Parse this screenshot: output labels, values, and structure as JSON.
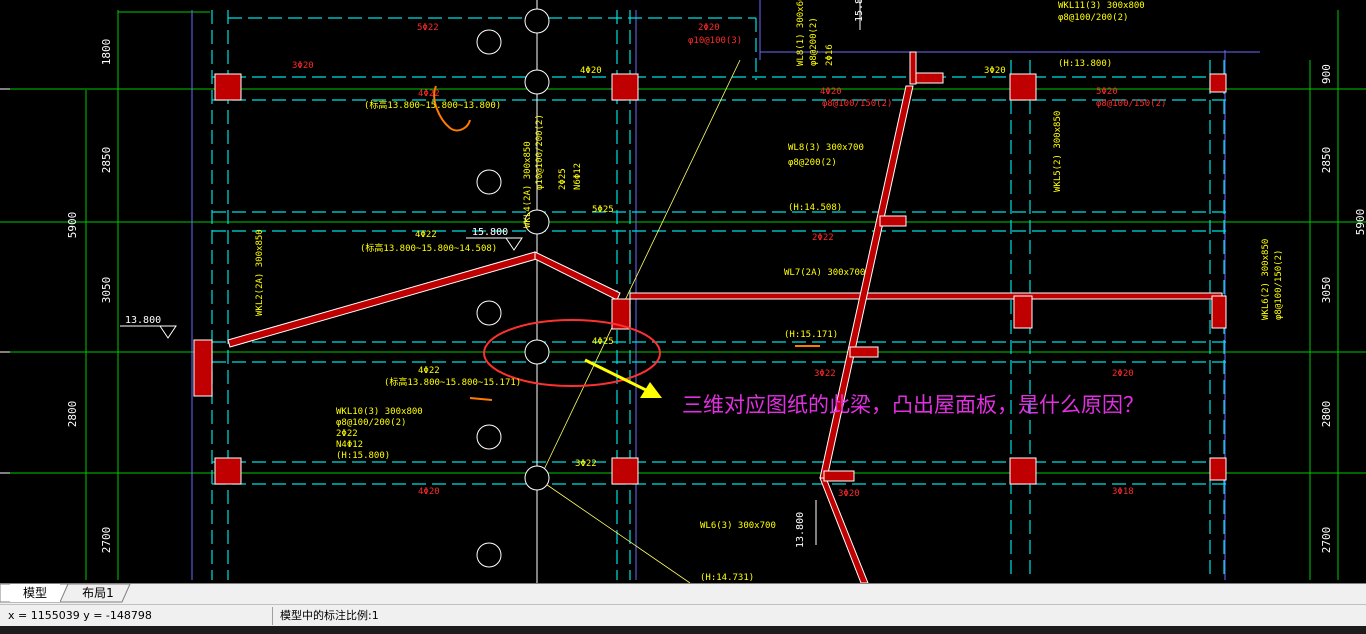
{
  "colors": {
    "background": "#000000",
    "axis": "#00c800",
    "dashed": "#00ffff",
    "beam_fill": "#c00000",
    "beam_edge": "#ffffff",
    "annot_yellow": "#ffff00",
    "annot_red": "#ff2a2a",
    "question_magenta": "#e030e0",
    "ellipse_red": "#ff3030",
    "arrow_yellow": "#ffff00",
    "orange_scribble": "#ff7a00",
    "circle_white": "#ffffff",
    "blue_line": "#6a6aff"
  },
  "dimensions_left": [
    "1800",
    "2850",
    "5900",
    "3050",
    "2800",
    "2700"
  ],
  "dimensions_right": [
    "900",
    "2850",
    "5900",
    "3050",
    "2800",
    "2700"
  ],
  "elevation_marks": [
    "13.800",
    "15.800",
    "15.800",
    "13.800"
  ],
  "beam_labels_yellow": [
    "WKL10(3) 300x800",
    "φ8@100/200(2)",
    "2Φ22",
    "N4Φ12",
    "(H:15.800)",
    "WKL2(2A) 300x850",
    "WKL4(2A) 300x850",
    "φ10@100/200(2)",
    "2Φ25",
    "N6Φ12",
    "WL8(3) 300x700",
    "φ8@200(2)",
    "(H:14.508)",
    "WL7(2A) 300x700",
    "(H:15.171)",
    "WL6(3) 300x700",
    "(H:14.731)",
    "WKL11(3) 300x800",
    "φ8@100/200(2)",
    "(H:13.800)",
    "WL8(1) 300x600",
    "φ8@200(2)",
    "2Φ16",
    "WKL6(2) 300x850",
    "φ8@100/150(2)",
    "WKL5(2) 300x850",
    "(标高13.800~15.800~13.800)",
    "(标高13.800~15.800~14.508)",
    "(标高13.800~15.800~15.171)",
    "4Φ22",
    "4Φ20",
    "4Φ22",
    "3Φ22",
    "5Φ25",
    "4Φ25",
    "3Φ20"
  ],
  "beam_labels_red": [
    "5Φ22",
    "2Φ20",
    "3Φ20",
    "4Φ22",
    "4Φ20",
    "3Φ22",
    "2Φ20",
    "3Φ18",
    "3Φ20",
    "φ8@100/150(2)",
    "φ10@100(3)",
    "4Φ20",
    "φ8@100/150(2)",
    "5Φ20",
    "2Φ22"
  ],
  "question_text": "三维对应图纸的此梁，凸出屋面板，是什么原因？",
  "tabs": [
    {
      "label": "模型",
      "active": true
    },
    {
      "label": "布局1",
      "active": false
    }
  ],
  "status": {
    "coords": "x = 1155039  y = -148798",
    "scale": "模型中的标注比例:1"
  }
}
